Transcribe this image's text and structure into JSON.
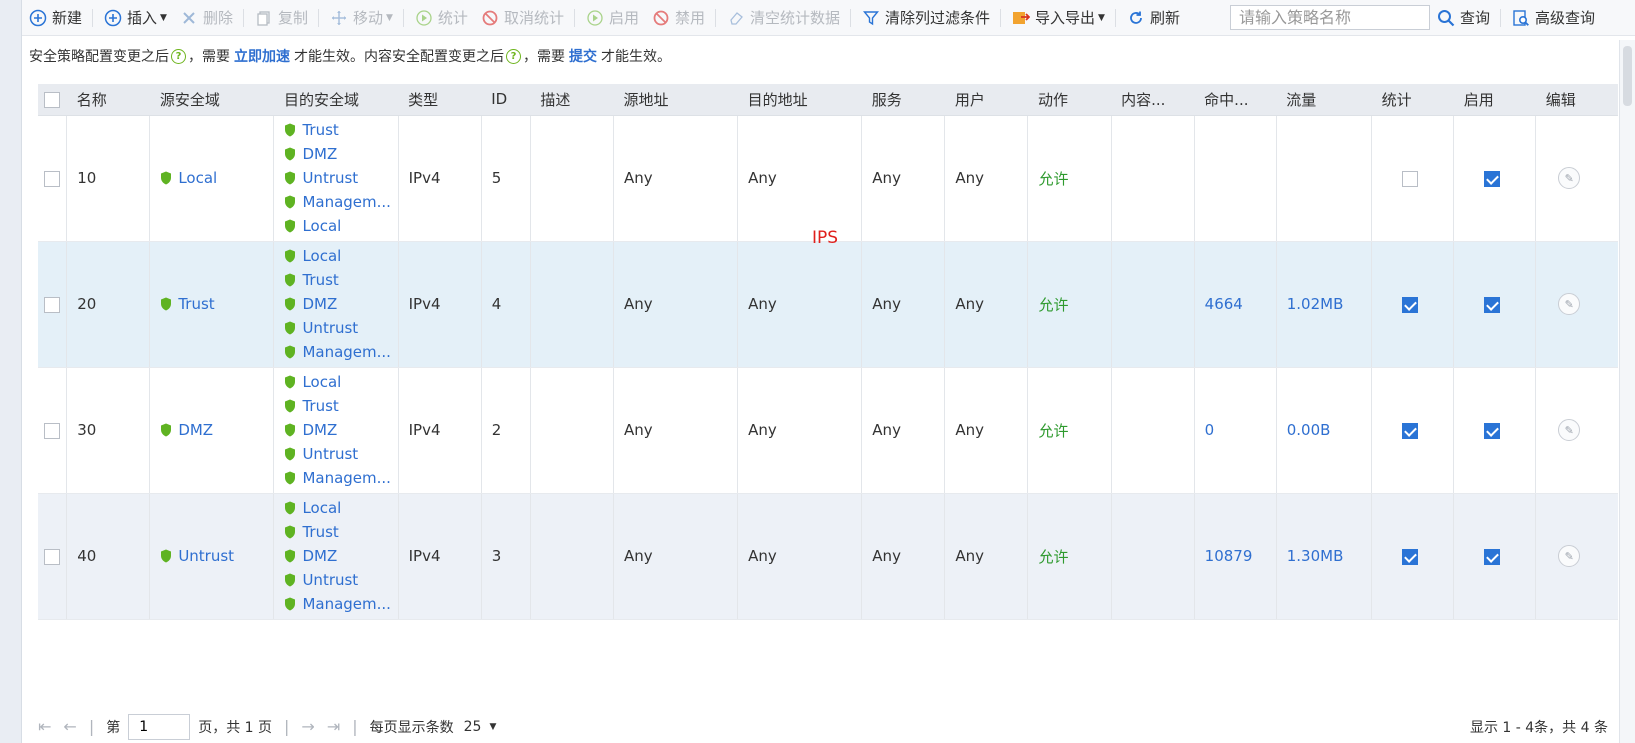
{
  "toolbar": {
    "new": "新建",
    "insert": "插入",
    "delete": "删除",
    "copy": "复制",
    "move": "移动",
    "stats": "统计",
    "cancel_stats": "取消统计",
    "enable": "启用",
    "disable": "禁用",
    "clear_stats": "清空统计数据",
    "clear_filter": "清除列过滤条件",
    "import_export": "导入导出",
    "refresh": "刷新",
    "search_placeholder": "请输入策略名称",
    "query": "查询",
    "advanced_query": "高级查询"
  },
  "notice": {
    "part1": "安全策略配置变更之后",
    "part2": "，需要",
    "link1": "立即加速",
    "part3": "才能生效。内容安全配置变更之后",
    "part4": "，需要",
    "link2": "提交",
    "part5": "才能生效。"
  },
  "columns": [
    "名称",
    "源安全域",
    "目的安全域",
    "类型",
    "ID",
    "描述",
    "源地址",
    "目的地址",
    "服务",
    "用户",
    "动作",
    "内容...",
    "命中...",
    "流量",
    "统计",
    "启用",
    "编辑"
  ],
  "rows": [
    {
      "name": "10",
      "src_zone": "Local",
      "dst_zones": [
        "Trust",
        "DMZ",
        "Untrust",
        "Managem...",
        "Local"
      ],
      "type": "IPv4",
      "id": "5",
      "desc": "",
      "src": "Any",
      "dst": "Any",
      "service": "Any",
      "user": "Any",
      "action": "允许",
      "content": "",
      "hits": "",
      "traffic": "",
      "stats_on": false,
      "enabled": true
    },
    {
      "name": "20",
      "src_zone": "Trust",
      "dst_zones": [
        "Local",
        "Trust",
        "DMZ",
        "Untrust",
        "Managem..."
      ],
      "type": "IPv4",
      "id": "4",
      "desc": "",
      "src": "Any",
      "dst": "Any",
      "service": "Any",
      "user": "Any",
      "action": "允许",
      "content": "",
      "hits": "4664",
      "traffic": "1.02MB",
      "stats_on": true,
      "enabled": true
    },
    {
      "name": "30",
      "src_zone": "DMZ",
      "dst_zones": [
        "Local",
        "Trust",
        "DMZ",
        "Untrust",
        "Managem..."
      ],
      "type": "IPv4",
      "id": "2",
      "desc": "",
      "src": "Any",
      "dst": "Any",
      "service": "Any",
      "user": "Any",
      "action": "允许",
      "content": "",
      "hits": "0",
      "traffic": "0.00B",
      "stats_on": true,
      "enabled": true
    },
    {
      "name": "40",
      "src_zone": "Untrust",
      "dst_zones": [
        "Local",
        "Trust",
        "DMZ",
        "Untrust",
        "Managem..."
      ],
      "type": "IPv4",
      "id": "3",
      "desc": "",
      "src": "Any",
      "dst": "Any",
      "service": "Any",
      "user": "Any",
      "action": "允许",
      "content": "",
      "hits": "10879",
      "traffic": "1.30MB",
      "stats_on": true,
      "enabled": true
    }
  ],
  "overlay_label": "IPS",
  "pager": {
    "page_prefix": "第",
    "page_value": "1",
    "page_suffix": "页，共 1 页",
    "per_page": "每页显示条数",
    "per_page_value": "25",
    "summary": "显示 1 - 4条，共 4 条"
  },
  "colors": {
    "link": "#2f6fd0",
    "allow": "#2e9a2e",
    "checkbox": "#2a74d6",
    "shield": "#5fb322",
    "overlay": "#e0201c"
  }
}
